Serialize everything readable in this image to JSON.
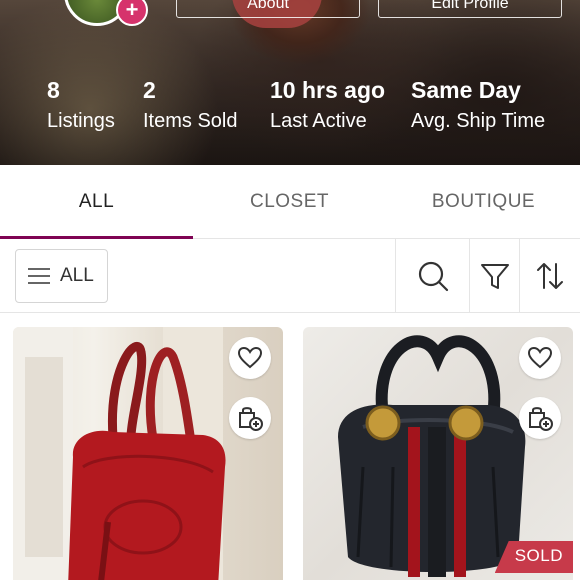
{
  "header": {
    "about_label": "About",
    "edit_label": "Edit Profile",
    "avatar_add_icon": "plus-icon",
    "stats": [
      {
        "value": "8",
        "label": "Listings"
      },
      {
        "value": "2",
        "label": "Items Sold"
      },
      {
        "value": "10 hrs ago",
        "label": "Last Active"
      },
      {
        "value": "Same Day",
        "label": "Avg. Ship Time"
      }
    ]
  },
  "tabs": [
    {
      "label": "ALL",
      "active": true
    },
    {
      "label": "CLOSET",
      "active": false
    },
    {
      "label": "BOUTIQUE",
      "active": false
    }
  ],
  "filter_bar": {
    "all_label": "ALL",
    "icons": [
      "menu-icon",
      "search-icon",
      "filter-icon",
      "sort-icon"
    ]
  },
  "listings": [
    {
      "image": "red leather hobo handbag",
      "like_icon": "heart-icon",
      "bundle_icon": "bag-plus-icon",
      "sold": false
    },
    {
      "image": "black leather hobo handbag with red stripe",
      "like_icon": "heart-icon",
      "bundle_icon": "bag-plus-icon",
      "sold": true,
      "sold_label": "SOLD"
    }
  ],
  "colors": {
    "accent": "#7f0353",
    "sold_badge": "#c73a4a",
    "avatar_add": "#d6336c"
  }
}
